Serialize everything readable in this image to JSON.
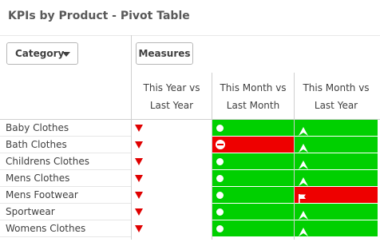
{
  "title": "KPIs by Product - Pivot Table",
  "dimension_button": {
    "label": "Category"
  },
  "measures_button": {
    "label": "Measures"
  },
  "columns": [
    {
      "line1": "This Year vs",
      "line2": "Last Year"
    },
    {
      "line1": "This Month vs",
      "line2": "Last Month"
    },
    {
      "line1": "This Month vs",
      "line2": "Last Year"
    }
  ],
  "rows": [
    {
      "label": "Baby Clothes",
      "year": "down",
      "month": "ok",
      "month_ly": "up"
    },
    {
      "label": "Bath Clothes",
      "year": "down",
      "month": "no-entry",
      "month_ly": "up"
    },
    {
      "label": "Childrens Clothes",
      "year": "down",
      "month": "ok",
      "month_ly": "up"
    },
    {
      "label": "Mens Clothes",
      "year": "down",
      "month": "ok",
      "month_ly": "up"
    },
    {
      "label": "Mens Footwear",
      "year": "down",
      "month": "ok",
      "month_ly": "flag"
    },
    {
      "label": "Sportwear",
      "year": "down",
      "month": "ok",
      "month_ly": "up"
    },
    {
      "label": "Womens Clothes",
      "year": "down",
      "month": "ok",
      "month_ly": "up"
    }
  ],
  "colors": {
    "good": "#00d000",
    "bad": "#ee0000",
    "trend_down": "#e00000",
    "text": "#404040",
    "title": "#595959"
  },
  "icons": {
    "down": "triangle-down-icon",
    "ok": "dot-icon",
    "no-entry": "no-entry-icon",
    "up": "arrow-up-icon",
    "flag": "flag-icon"
  }
}
